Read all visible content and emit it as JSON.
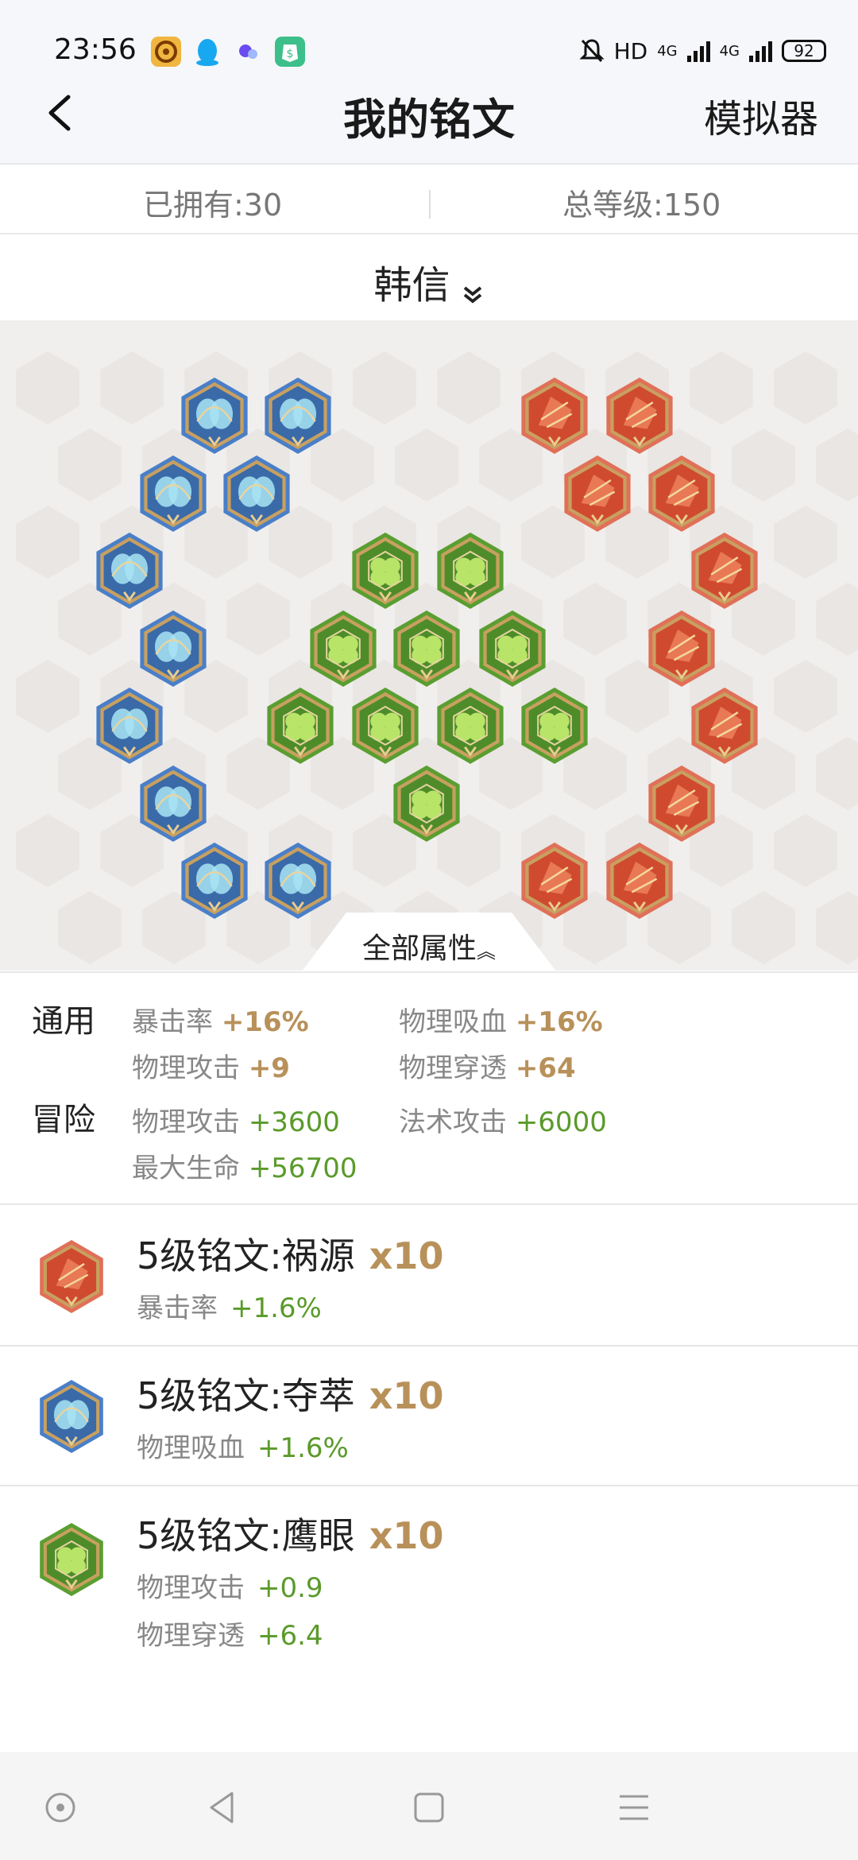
{
  "status": {
    "time": "23:56",
    "hd": "HD",
    "net1": "4G",
    "net2": "4G",
    "battery": "92",
    "app_icons": [
      "app-target-icon",
      "qq-icon",
      "dot-app-icon",
      "wallet-app-icon"
    ]
  },
  "header": {
    "back_icon": "chevron-left-icon",
    "title": "我的铭文",
    "simulator": "模拟器"
  },
  "stats": {
    "owned": "已拥有:30",
    "level": "总等级:150"
  },
  "hero": {
    "name": "韩信"
  },
  "attr_tab": {
    "label": "全部属性"
  },
  "attributes": {
    "general": {
      "label": "通用",
      "items": [
        {
          "name": "暴击率",
          "value": "+16%"
        },
        {
          "name": "物理吸血",
          "value": "+16%"
        },
        {
          "name": "物理攻击",
          "value": "+9"
        },
        {
          "name": "物理穿透",
          "value": "+64"
        }
      ]
    },
    "adventure": {
      "label": "冒险",
      "items": [
        {
          "name": "物理攻击",
          "value": "+3600"
        },
        {
          "name": "法术攻击",
          "value": "+6000"
        },
        {
          "name": "最大生命",
          "value": "+56700"
        }
      ]
    }
  },
  "runes": [
    {
      "name": "5级铭文:祸源",
      "count": "x10",
      "color": "red",
      "stats": [
        {
          "name": "暴击率",
          "value": "+1.6%"
        }
      ]
    },
    {
      "name": "5级铭文:夺萃",
      "count": "x10",
      "color": "blue",
      "stats": [
        {
          "name": "物理吸血",
          "value": "+1.6%"
        }
      ]
    },
    {
      "name": "5级铭文:鹰眼",
      "count": "x10",
      "color": "green",
      "stats": [
        {
          "name": "物理攻击",
          "value": "+0.9"
        },
        {
          "name": "物理穿透",
          "value": "+6.4"
        }
      ]
    }
  ],
  "colors": {
    "red": "#d3553a",
    "blue": "#4a7fc8",
    "green": "#5a9e32",
    "gold": "#b8915a",
    "value_green": "#5a9a2a"
  },
  "navbar": [
    "nav-home-icon",
    "nav-back-icon",
    "nav-recents-icon",
    "nav-menu-icon"
  ]
}
